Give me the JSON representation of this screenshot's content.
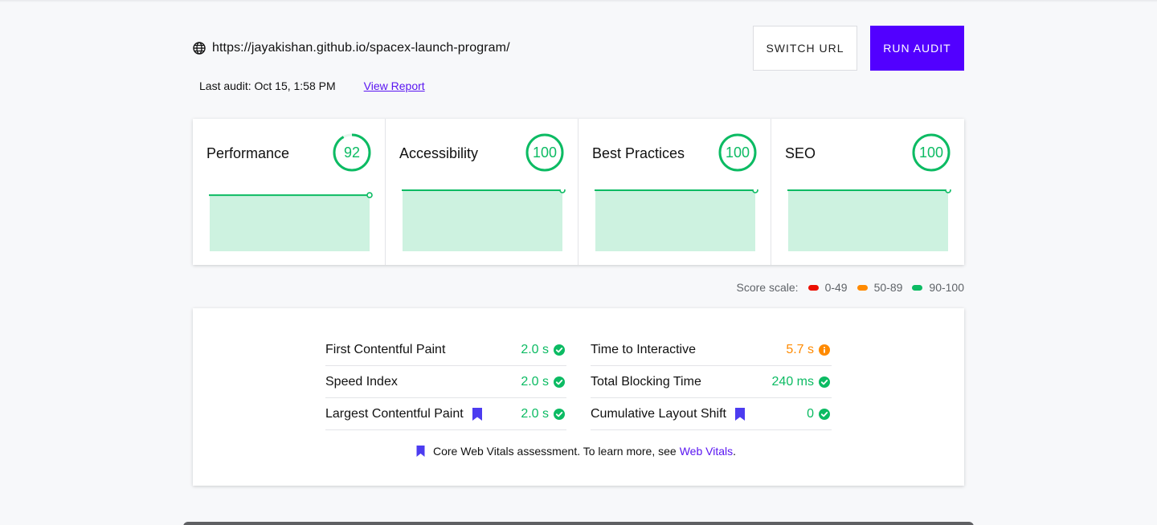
{
  "header": {
    "url": "https://jayakishan.github.io/spacex-launch-program/",
    "last_audit": "Last audit: Oct 15, 1:58 PM",
    "view_report": "View Report",
    "switch_url_label": "SWITCH URL",
    "run_audit_label": "RUN AUDIT"
  },
  "scores": [
    {
      "title": "Performance",
      "score": "92",
      "value": 92
    },
    {
      "title": "Accessibility",
      "score": "100",
      "value": 100
    },
    {
      "title": "Best Practices",
      "score": "100",
      "value": 100
    },
    {
      "title": "SEO",
      "score": "100",
      "value": 100
    }
  ],
  "scale": {
    "label": "Score scale:",
    "ranges": [
      {
        "label": "0-49",
        "color": "#eb0f00"
      },
      {
        "label": "50-89",
        "color": "#ff8a00"
      },
      {
        "label": "90-100",
        "color": "#0cbb63"
      }
    ]
  },
  "metrics": {
    "left": [
      {
        "label": "First Contentful Paint",
        "value": "2.0 s",
        "status": "pass",
        "core": false
      },
      {
        "label": "Speed Index",
        "value": "2.0 s",
        "status": "pass",
        "core": false
      },
      {
        "label": "Largest Contentful Paint",
        "value": "2.0 s",
        "status": "pass",
        "core": true
      }
    ],
    "right": [
      {
        "label": "Time to Interactive",
        "value": "5.7 s",
        "status": "average",
        "core": false
      },
      {
        "label": "Total Blocking Time",
        "value": "240 ms",
        "status": "pass",
        "core": false
      },
      {
        "label": "Cumulative Layout Shift",
        "value": "0",
        "status": "pass",
        "core": true
      }
    ],
    "footer_text": "Core Web Vitals assessment. To learn more, see",
    "footer_link": "Web Vitals",
    "footer_period": "."
  },
  "colors": {
    "pass": "#0cbb63",
    "average": "#ff8a00",
    "accent": "#5200ff",
    "link": "#5a16f1",
    "bookmark": "#4c3cf0"
  }
}
